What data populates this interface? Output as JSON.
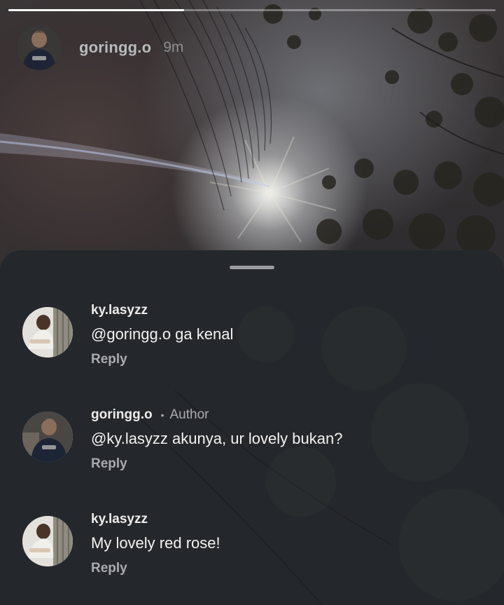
{
  "story": {
    "username": "goringg.o",
    "time_ago": "9m",
    "progress": 0.36
  },
  "comments": [
    {
      "username": "ky.lasyzz",
      "author_badge": "",
      "text": "@goringg.o ga kenal",
      "reply_label": "Reply"
    },
    {
      "username": "goringg.o",
      "author_badge": "Author",
      "text": "@ky.lasyzz akunya, ur lovely bukan?",
      "reply_label": "Reply"
    },
    {
      "username": "ky.lasyzz",
      "author_badge": "",
      "text": "My lovely red rose!",
      "reply_label": "Reply"
    }
  ]
}
